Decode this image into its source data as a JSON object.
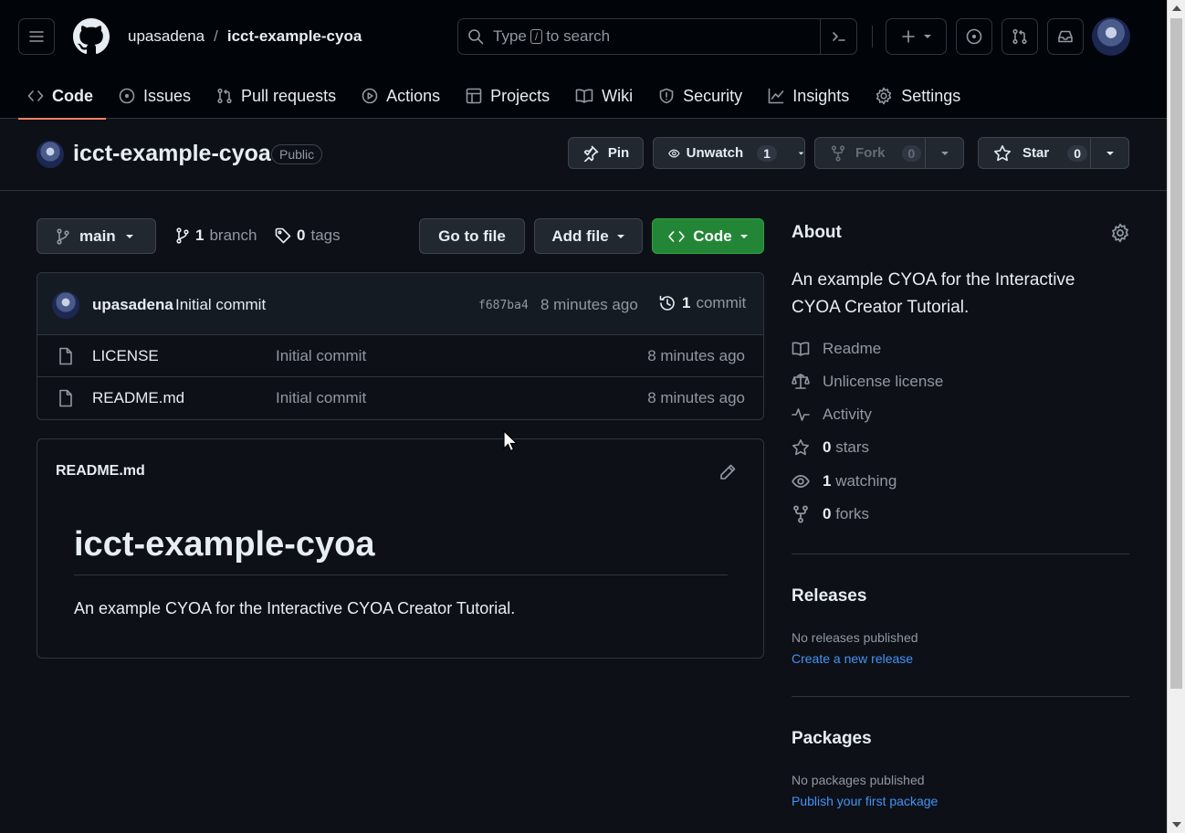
{
  "header": {
    "owner": "upasadena",
    "separator": "/",
    "repo": "icct-example-cyoa",
    "search_prefix": "Type",
    "search_key": "/",
    "search_suffix": "to search"
  },
  "nav": {
    "tabs": [
      {
        "label": "Code",
        "icon": "code-icon"
      },
      {
        "label": "Issues",
        "icon": "issue-opened-icon"
      },
      {
        "label": "Pull requests",
        "icon": "git-pull-request-icon"
      },
      {
        "label": "Actions",
        "icon": "play-icon"
      },
      {
        "label": "Projects",
        "icon": "table-icon"
      },
      {
        "label": "Wiki",
        "icon": "book-icon"
      },
      {
        "label": "Security",
        "icon": "shield-icon"
      },
      {
        "label": "Insights",
        "icon": "graph-icon"
      },
      {
        "label": "Settings",
        "icon": "gear-icon"
      }
    ]
  },
  "repo": {
    "title": "icct-example-cyoa",
    "visibility": "Public",
    "pin_label": "Pin",
    "watch_label": "Unwatch",
    "watch_count": "1",
    "fork_label": "Fork",
    "fork_count": "0",
    "star_label": "Star",
    "star_count": "0"
  },
  "branch": {
    "name": "main",
    "branch_count": "1",
    "branch_label": "branch",
    "tag_count": "0",
    "tag_label": "tags",
    "goto_label": "Go to file",
    "addfile_label": "Add file",
    "code_label": "Code"
  },
  "commit": {
    "author": "upasadena",
    "message": "Initial commit",
    "hash": "f687ba4",
    "time": "8 minutes ago",
    "count": "1",
    "count_label": "commit"
  },
  "files": [
    {
      "name": "LICENSE",
      "message": "Initial commit",
      "time": "8 minutes ago"
    },
    {
      "name": "README.md",
      "message": "Initial commit",
      "time": "8 minutes ago"
    }
  ],
  "readme": {
    "file_label": "README.md",
    "heading": "icct-example-cyoa",
    "body": "An example CYOA for the Interactive CYOA Creator Tutorial."
  },
  "about": {
    "title": "About",
    "description": "An example CYOA for the Interactive CYOA Creator Tutorial.",
    "readme": "Readme",
    "license": "Unlicense license",
    "activity": "Activity",
    "stars_count": "0",
    "stars_label": "stars",
    "watching_count": "1",
    "watching_label": "watching",
    "forks_count": "0",
    "forks_label": "forks"
  },
  "releases": {
    "title": "Releases",
    "empty": "No releases published",
    "link": "Create a new release"
  },
  "packages": {
    "title": "Packages",
    "empty": "No packages published",
    "link": "Publish your first package"
  },
  "colors": {
    "background": "#0d1117",
    "header": "#010409",
    "accent_tab": "#f78166",
    "primary_button": "#238636",
    "link": "#4493f8"
  }
}
